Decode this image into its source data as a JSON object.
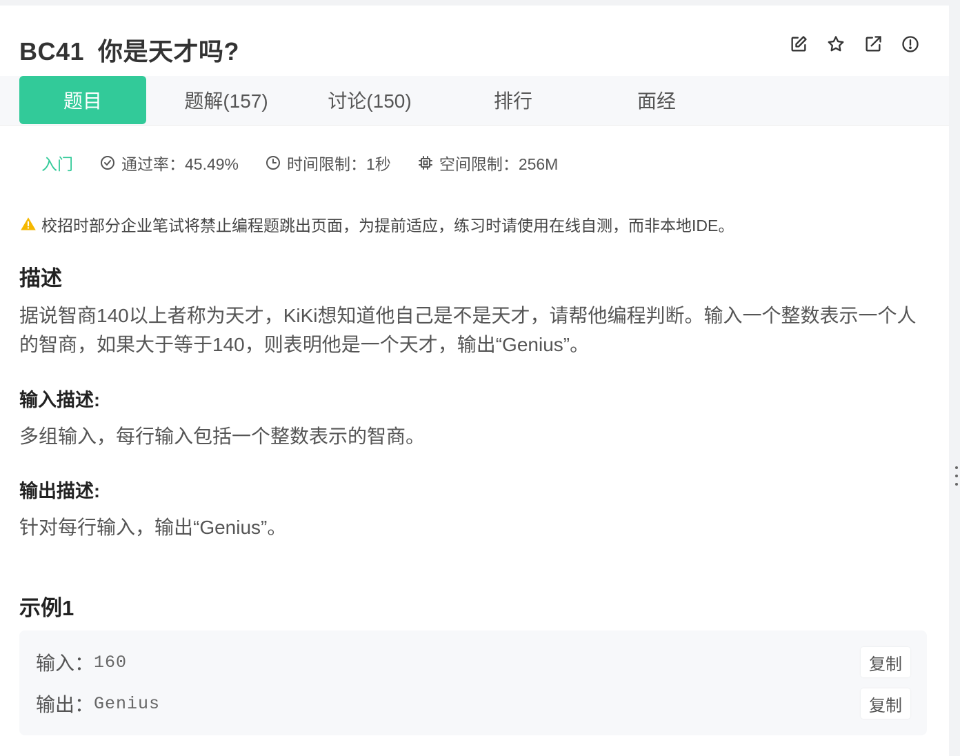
{
  "problem": {
    "code": "BC41",
    "title": "你是天才吗?"
  },
  "header_icons": [
    "edit-icon",
    "star-icon",
    "external-link-icon",
    "report-icon"
  ],
  "tabs": [
    {
      "label": "题目",
      "active": true
    },
    {
      "label": "题解(157)"
    },
    {
      "label": "讨论(150)"
    },
    {
      "label": "排行"
    },
    {
      "label": "面经"
    }
  ],
  "meta": {
    "level": "入门",
    "pass_rate": "通过率：45.49%",
    "time_limit": "时间限制：1秒",
    "memory_limit": "空间限制：256M"
  },
  "warning": "校招时部分企业笔试将禁止编程题跳出页面，为提前适应，练习时请使用在线自测，而非本地IDE。",
  "description": {
    "heading": "描述",
    "text": "据说智商140以上者称为天才，KiKi想知道他自己是不是天才，请帮他编程判断。输入一个整数表示一个人的智商，如果大于等于140，则表明他是一个天才，输出“Genius”。"
  },
  "input_desc": {
    "heading": "输入描述:",
    "text": "多组输入，每行输入包括一个整数表示的智商。"
  },
  "output_desc": {
    "heading": "输出描述:",
    "text": "针对每行输入，输出“Genius”。"
  },
  "example": {
    "heading": "示例1",
    "input_label": "输入：",
    "input_value": "160",
    "output_label": "输出：",
    "output_value": "Genius",
    "copy_label": "复制"
  },
  "colors": {
    "accent": "#32ca99",
    "warning": "#f5b800"
  }
}
